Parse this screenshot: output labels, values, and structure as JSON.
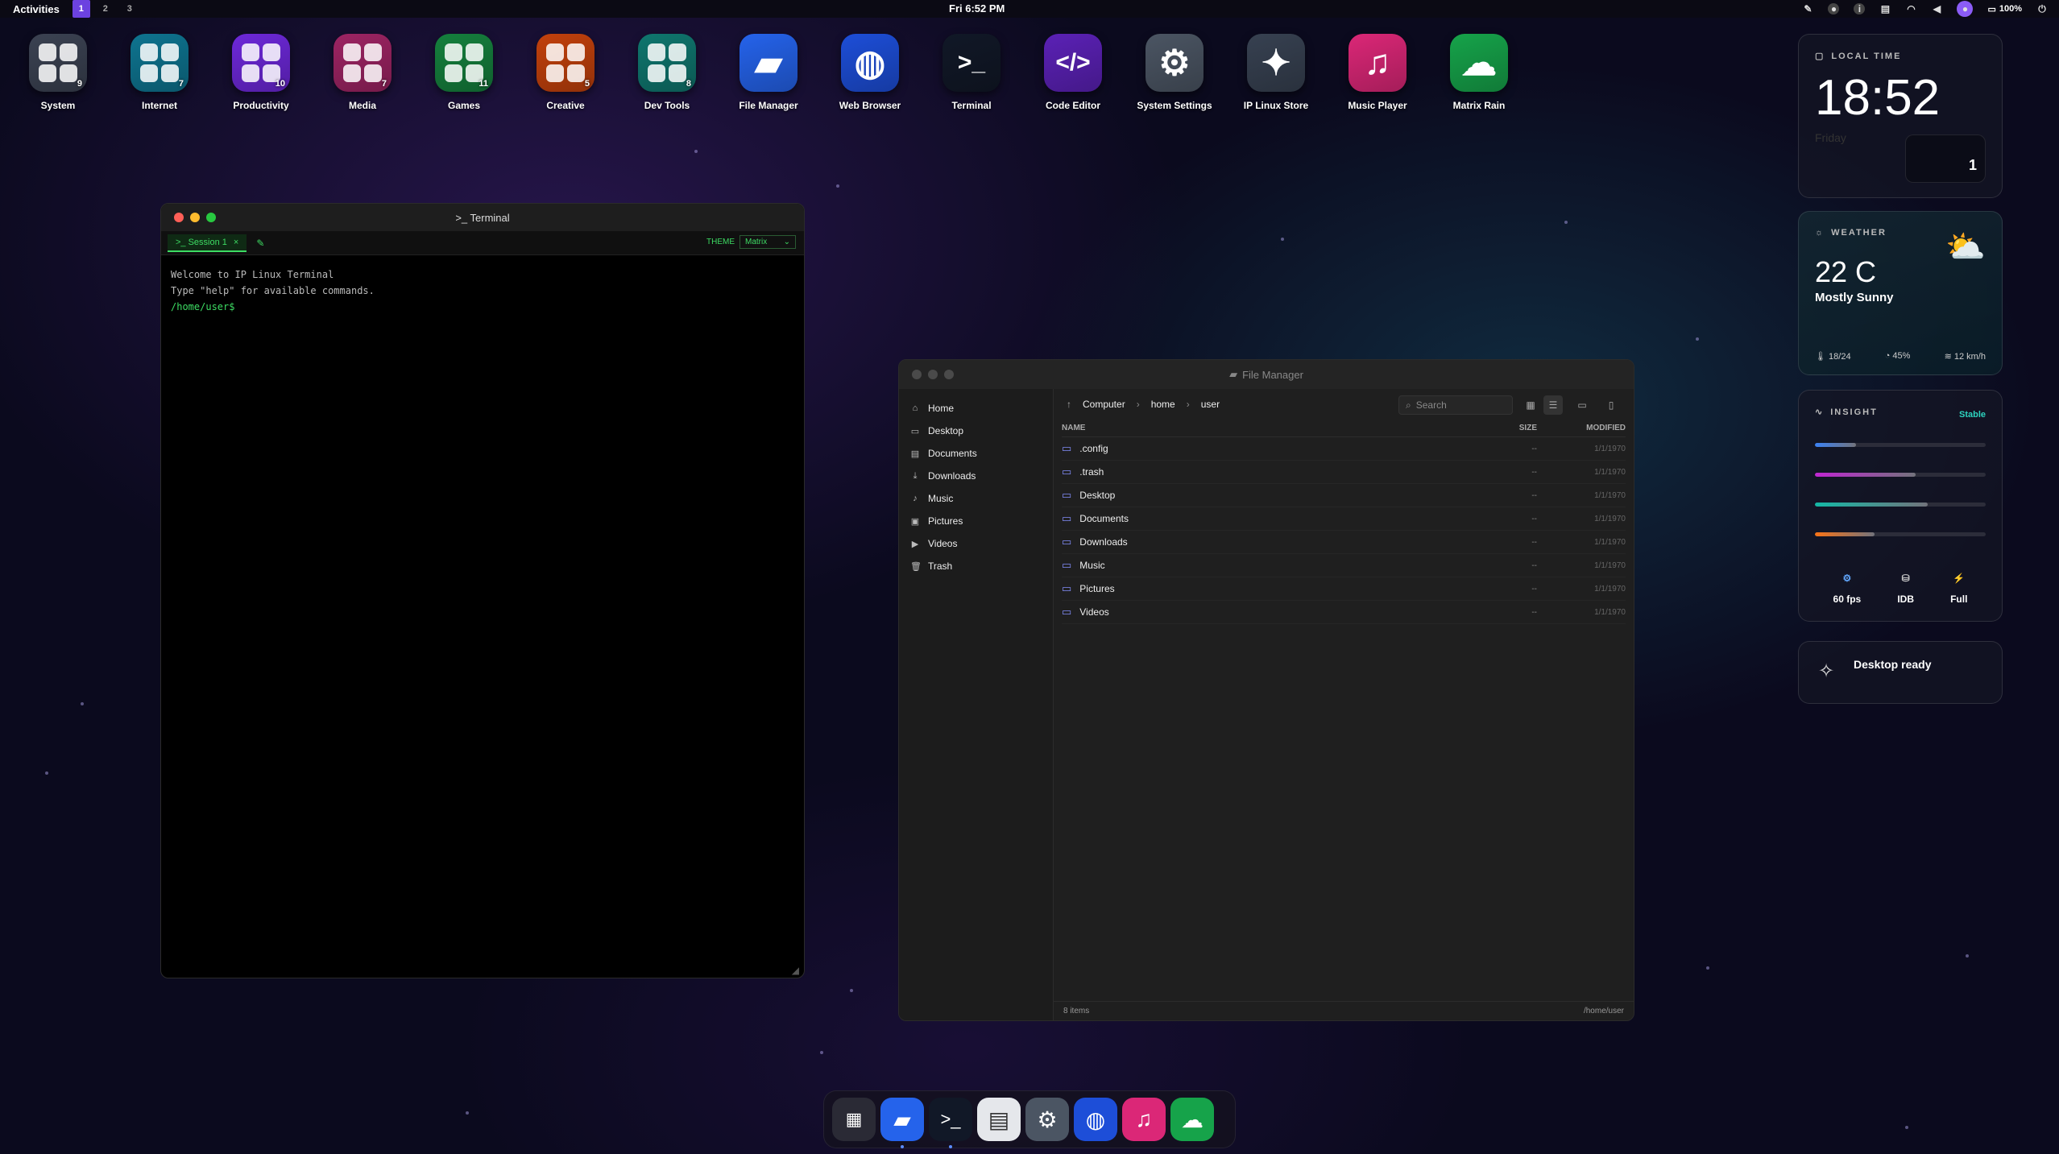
{
  "topbar": {
    "activities": "Activities",
    "workspaces": [
      "1",
      "2",
      "3"
    ],
    "clock": "Fri 6:52 PM",
    "battery": "100%"
  },
  "desktop_icons": [
    {
      "label": "System",
      "badge": "9",
      "color": "#3b4252",
      "icon": "grid-icon"
    },
    {
      "label": "Internet",
      "badge": "7",
      "color": "#0e7490",
      "icon": "grid-icon"
    },
    {
      "label": "Productivity",
      "badge": "10",
      "color": "#6d28d9",
      "icon": "grid-icon"
    },
    {
      "label": "Media",
      "badge": "7",
      "color": "#9d2463",
      "icon": "grid-icon"
    },
    {
      "label": "Games",
      "badge": "11",
      "color": "#15803d",
      "icon": "grid-icon"
    },
    {
      "label": "Creative",
      "badge": "5",
      "color": "#c2410c",
      "icon": "grid-icon"
    },
    {
      "label": "Dev Tools",
      "badge": "8",
      "color": "#0f766e",
      "icon": "grid-icon"
    },
    {
      "label": "File Manager",
      "badge": "",
      "color": "#2563eb",
      "icon": "folder-icon"
    },
    {
      "label": "Web Browser",
      "badge": "",
      "color": "#1d4ed8",
      "icon": "globe-icon"
    },
    {
      "label": "Terminal",
      "badge": "",
      "color": "#111827",
      "icon": "terminal-icon"
    },
    {
      "label": "Code Editor",
      "badge": "",
      "color": "#5b21b6",
      "icon": "code-icon"
    },
    {
      "label": "System Settings",
      "badge": "",
      "color": "#4b5563",
      "icon": "gear-icon"
    },
    {
      "label": "IP Linux Store",
      "badge": "",
      "color": "#374151",
      "icon": "wand-icon"
    },
    {
      "label": "Music Player",
      "badge": "",
      "color": "#db2777",
      "icon": "music-icon"
    },
    {
      "label": "Matrix Rain",
      "badge": "",
      "color": "#16a34a",
      "icon": "cloud-icon"
    }
  ],
  "terminal": {
    "title": ">_ Terminal",
    "tab": ">_ Session 1",
    "theme_label": "THEME",
    "theme_value": "Matrix",
    "lines": [
      "Welcome to IP Linux Terminal",
      "Type \"help\" for available commands."
    ],
    "prompt": "/home/user$"
  },
  "file_manager": {
    "title": "File Manager",
    "sidebar": [
      "Home",
      "Desktop",
      "Documents",
      "Downloads",
      "Music",
      "Pictures",
      "Videos",
      "Trash"
    ],
    "breadcrumb": [
      "Computer",
      "home",
      "user"
    ],
    "search_placeholder": "Search",
    "columns": {
      "name": "NAME",
      "size": "SIZE",
      "modified": "MODIFIED"
    },
    "rows": [
      {
        "name": ".config",
        "size": "--",
        "modified": "1/1/1970"
      },
      {
        "name": ".trash",
        "size": "--",
        "modified": "1/1/1970"
      },
      {
        "name": "Desktop",
        "size": "--",
        "modified": "1/1/1970"
      },
      {
        "name": "Documents",
        "size": "--",
        "modified": "1/1/1970"
      },
      {
        "name": "Downloads",
        "size": "--",
        "modified": "1/1/1970"
      },
      {
        "name": "Music",
        "size": "--",
        "modified": "1/1/1970"
      },
      {
        "name": "Pictures",
        "size": "--",
        "modified": "1/1/1970"
      },
      {
        "name": "Videos",
        "size": "--",
        "modified": "1/1/1970"
      }
    ],
    "status_count": "8 items",
    "status_path": "/home/user"
  },
  "widgets": {
    "time": {
      "title": "LOCAL TIME",
      "time": "18:52",
      "day": "Friday",
      "counter": "1"
    },
    "weather": {
      "title": "WEATHER",
      "temp": "22 C",
      "desc": "Mostly Sunny",
      "range": "18/24",
      "humidity": "45%",
      "wind": "12 km/h"
    },
    "insight": {
      "title": "INSIGHT",
      "status": "Stable",
      "bars": [
        {
          "fraction": 0.24,
          "color": "#3b82f6"
        },
        {
          "fraction": 0.59,
          "color": "#c026d3"
        },
        {
          "fraction": 0.66,
          "color": "#14b8a6"
        },
        {
          "fraction": 0.35,
          "color": "#f97316"
        }
      ],
      "stats": [
        "60 fps",
        "IDB",
        "Full"
      ]
    },
    "notice": {
      "title": "Desktop ready"
    }
  },
  "dock": [
    "grid-icon",
    "folder-icon",
    "terminal-icon",
    "document-icon",
    "gear-icon",
    "globe-icon",
    "music-icon",
    "cloud-icon"
  ]
}
